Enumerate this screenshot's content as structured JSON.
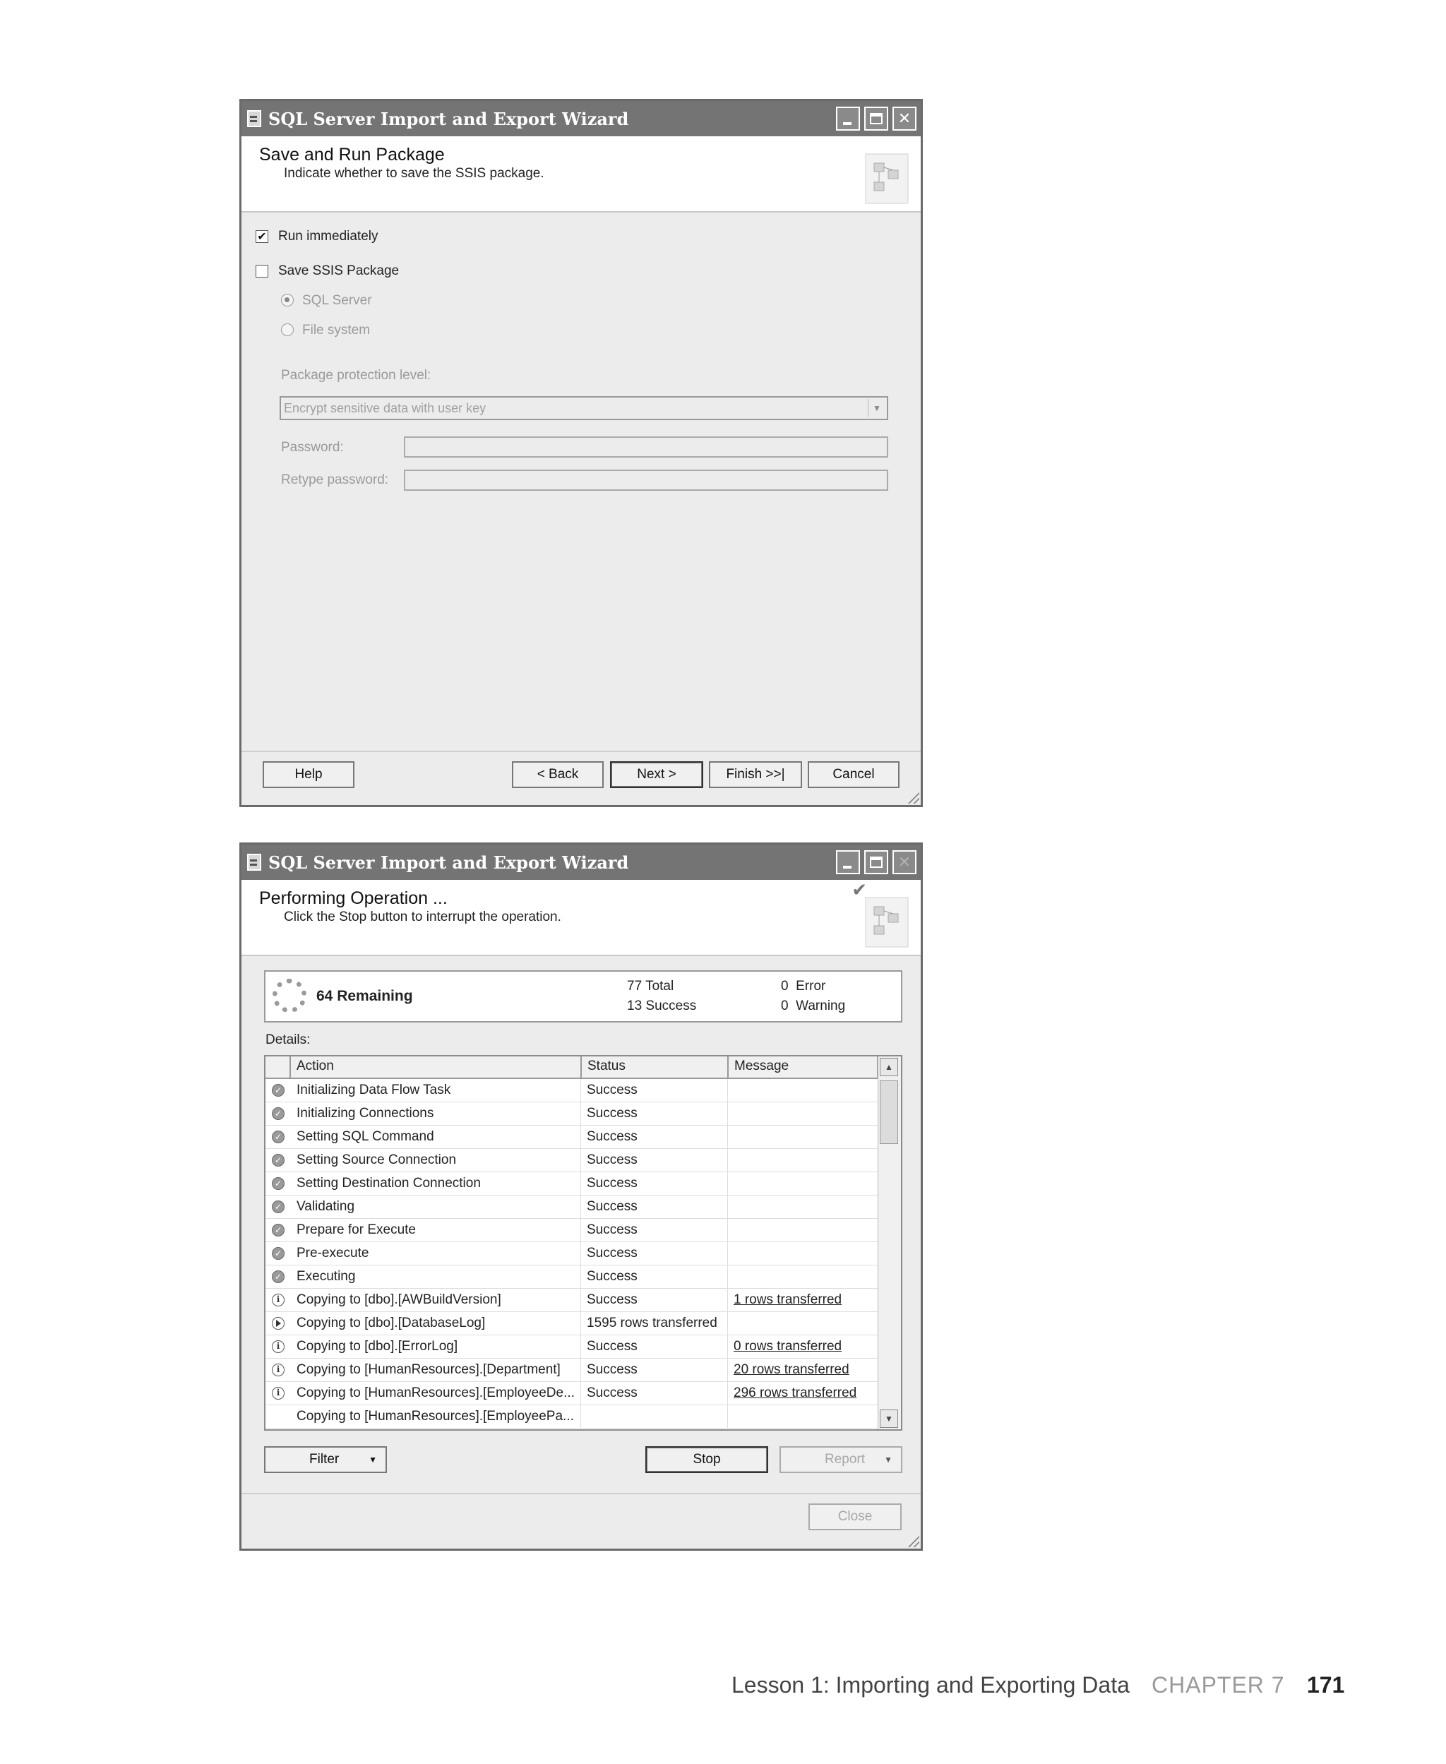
{
  "window1": {
    "title": "SQL Server Import and Export Wizard",
    "header_title": "Save and Run Package",
    "header_subtitle": "Indicate whether to save the SSIS package.",
    "run_immediately": {
      "label": "Run immediately",
      "checked": true,
      "mark": "✔"
    },
    "save_ssis": {
      "label": "Save SSIS Package",
      "checked": false
    },
    "radio_sql_server": "SQL Server",
    "radio_file_system": "File system",
    "protection_label": "Package protection level:",
    "protection_value": "Encrypt sensitive data with user key",
    "password_label": "Password:",
    "retype_label": "Retype password:",
    "buttons": {
      "help": "Help",
      "back": "< Back",
      "next": "Next >",
      "finish": "Finish >>|",
      "cancel": "Cancel"
    }
  },
  "window2": {
    "title": "SQL Server Import and Export Wizard",
    "header_title": "Performing Operation ...",
    "header_subtitle": "Click the Stop button to interrupt the operation.",
    "summary": {
      "remaining": "64 Remaining",
      "total": "77 Total",
      "success": "13 Success",
      "error": "0  Error",
      "warning": "0  Warning"
    },
    "details_label": "Details:",
    "columns": {
      "action": "Action",
      "status": "Status",
      "message": "Message"
    },
    "rows": [
      {
        "icon": "success",
        "action": "Initializing Data Flow Task",
        "status": "Success",
        "message": ""
      },
      {
        "icon": "success",
        "action": "Initializing Connections",
        "status": "Success",
        "message": ""
      },
      {
        "icon": "success",
        "action": "Setting SQL Command",
        "status": "Success",
        "message": ""
      },
      {
        "icon": "success",
        "action": "Setting Source Connection",
        "status": "Success",
        "message": ""
      },
      {
        "icon": "success",
        "action": "Setting Destination Connection",
        "status": "Success",
        "message": ""
      },
      {
        "icon": "success",
        "action": "Validating",
        "status": "Success",
        "message": ""
      },
      {
        "icon": "success",
        "action": "Prepare for Execute",
        "status": "Success",
        "message": ""
      },
      {
        "icon": "success",
        "action": "Pre-execute",
        "status": "Success",
        "message": ""
      },
      {
        "icon": "success",
        "action": "Executing",
        "status": "Success",
        "message": ""
      },
      {
        "icon": "info",
        "action": "Copying to [dbo].[AWBuildVersion]",
        "status": "Success",
        "message": "1 rows transferred"
      },
      {
        "icon": "running",
        "action": "Copying to [dbo].[DatabaseLog]",
        "status": "1595 rows transferred",
        "message": ""
      },
      {
        "icon": "info",
        "action": "Copying to [dbo].[ErrorLog]",
        "status": "Success",
        "message": "0 rows transferred"
      },
      {
        "icon": "info",
        "action": "Copying to [HumanResources].[Department]",
        "status": "Success",
        "message": "20 rows transferred"
      },
      {
        "icon": "info",
        "action": "Copying to [HumanResources].[EmployeeDe...",
        "status": "Success",
        "message": "296 rows transferred"
      },
      {
        "icon": "none",
        "action": "Copying to [HumanResources].[EmployeePa...",
        "status": "",
        "message": ""
      }
    ],
    "buttons": {
      "filter": "Filter",
      "stop": "Stop",
      "report": "Report",
      "close": "Close"
    }
  },
  "footer": {
    "lesson": "Lesson 1: Importing and Exporting Data",
    "chapter": "CHAPTER 7",
    "page": "171"
  }
}
